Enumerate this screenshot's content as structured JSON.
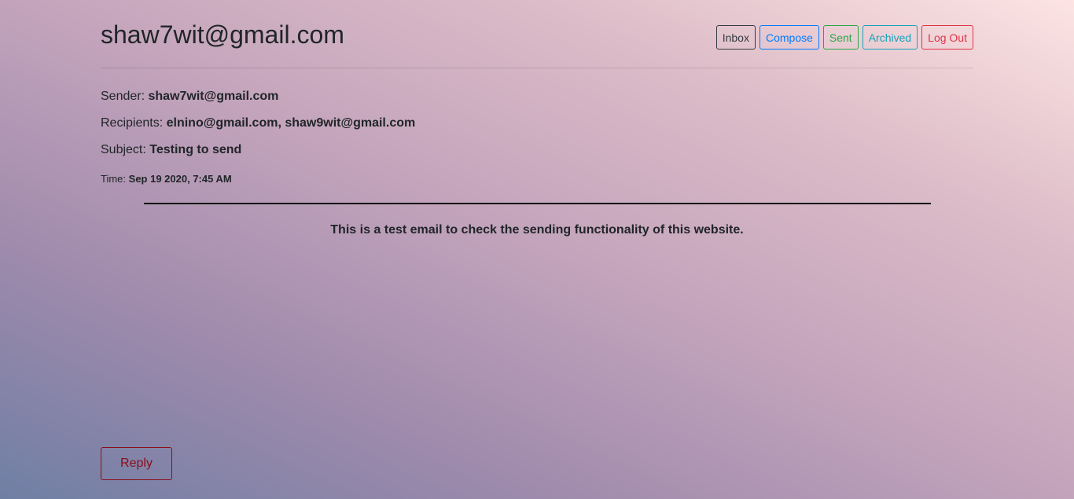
{
  "header": {
    "user_email": "shaw7wit@gmail.com",
    "nav": {
      "inbox": "Inbox",
      "compose": "Compose",
      "sent": "Sent",
      "archived": "Archived",
      "logout": "Log Out"
    }
  },
  "email": {
    "sender_label": "Sender:",
    "sender": "shaw7wit@gmail.com",
    "recipients_label": "Recipients:",
    "recipients": "elnino@gmail.com, shaw9wit@gmail.com",
    "subject_label": "Subject:",
    "subject": "Testing to send",
    "time_label": "Time:",
    "time": "Sep 19 2020, 7:45 AM",
    "body": "This is a test email to check the sending functionality of this website.",
    "reply_label": "Reply"
  }
}
